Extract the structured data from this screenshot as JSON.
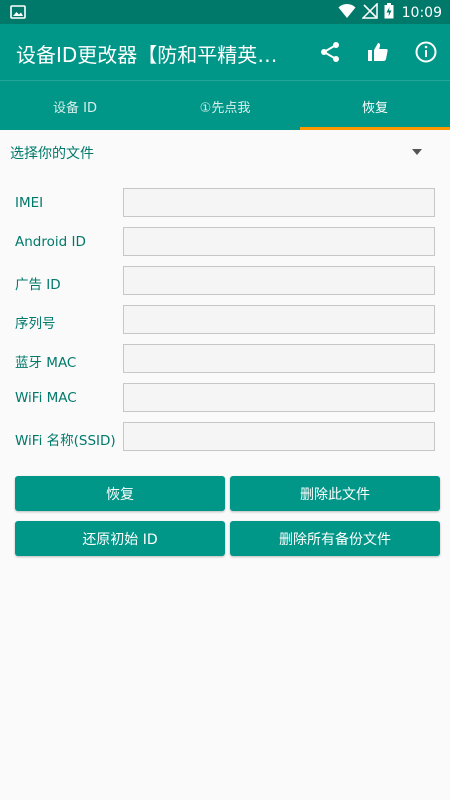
{
  "status_bar": {
    "time": "10:09",
    "icons": [
      "image-notification-icon",
      "wifi-icon",
      "no-signal-icon",
      "battery-charging-icon"
    ]
  },
  "app_bar": {
    "title": "设备ID更改器【防和平精英隔离",
    "actions": [
      "share-icon",
      "thumbs-up-icon",
      "info-icon"
    ]
  },
  "tabs": [
    {
      "label": "设备 ID",
      "active": false
    },
    {
      "label": "①先点我",
      "active": false
    },
    {
      "label": "恢复",
      "active": true
    }
  ],
  "colors": {
    "primary": "#009688",
    "primary_dark": "#00796b",
    "accent": "#ff9800",
    "label_text": "#00796b"
  },
  "file_select": {
    "label": "选择你的文件"
  },
  "fields": [
    {
      "label": "IMEI",
      "value": ""
    },
    {
      "label": "Android ID",
      "value": ""
    },
    {
      "label": "广告 ID",
      "value": ""
    },
    {
      "label": "序列号",
      "value": ""
    },
    {
      "label": "蓝牙 MAC",
      "value": ""
    },
    {
      "label": "WiFi MAC",
      "value": ""
    },
    {
      "label": "WiFi 名称(SSID)",
      "value": ""
    }
  ],
  "buttons": {
    "restore": "恢复",
    "delete_file": "删除此文件",
    "restore_original": "还原初始 ID",
    "delete_all_backups": "删除所有备份文件"
  }
}
